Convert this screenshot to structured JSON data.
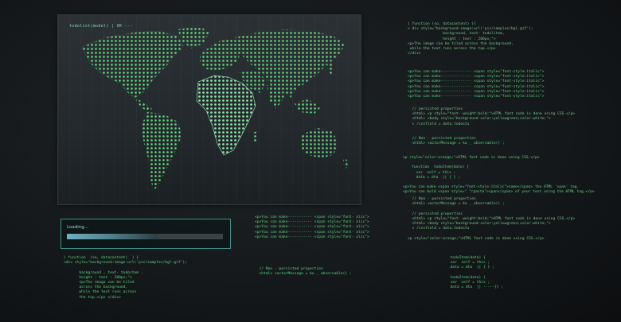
{
  "map": {
    "title": "todolist(model) | OK ---"
  },
  "loading": {
    "label": "Loading...",
    "progress": 0.58
  },
  "code_right_top": [
    "( function (so, datacontent) ){",
    "< div style=\"background-image:url('pic/samples/bgl.gif');",
    "                background, text- todolitem,",
    "                height : text : 200px;\">",
    "<p>The image can be tiled across the background,",
    " while the text runs across the top.</p>",
    "</div>"
  ],
  "code_right_mid": [
    "<p>You can make-------------- <span style=\"font-style:italic\">",
    "<p>You can make-------------- <span style=\"font-style:italic\">",
    "<p>You can make-------------- <span style=\"font-style:italic\">",
    "<p>You can make-------------- <span style=\"font-style:italic\">",
    "<p>You can make-------------- <span style=\"font-style:italic\">",
    "<p>You can make-------------- <span style=\"font-style:italic\">"
  ],
  "code_right_persisted": [
    "  // persisted properties",
    "  <html> <p style=\"font- weight:bold;\">HTML font code is done using CSS.</p>",
    "  <html> <body style=\"background-color:yellowgreen;color:white;\">",
    "  < /cssfield = data.todostu"
  ],
  "code_right_nonpersist": [
    "  // Non - persisted properties",
    "  <html> <actorMessage = ko _ observable() ;"
  ],
  "code_right_css": [
    "<p style=\"color:orange;\">HTML font code is done using CSS.</p>",
    "",
    "    function  todoItem(data) {",
    "      var  self = this ;",
    "      data = dta  || { } ;",
    "",
    "<p>You can make <span style=\"font-style:italic\">some</span> the HTML 'span' tag.",
    "<p>You can bold <span style=\" \"rpacte\">span</span> of your text using the HTML tag.</p>"
  ],
  "code_right_lower": [
    "  // Non - persisted properties",
    "  <html> <actorMessage = ko _ observable() ;",
    "",
    "  // persisted properties",
    "  <html> <p style=\"font- weight:bold;\">HTML font code is done using CSS.</p>",
    "  <html> <body style=\"background-color:yellowgreen;color:white;\">",
    "  < /cssfield = data.todostu",
    "",
    "<p style=\"color:orange;\">HTML font code is done using CSS.</p>"
  ],
  "code_right_bottom": [
    "  todoItem(data) {",
    "  var  self = this ;",
    "  data = dta  || { } ;",
    "",
    "  todoItem(data) {",
    "  var  self = this ;",
    "  data = dta  || -----{} ;"
  ],
  "code_center": [
    "<p>You can make----------- <span style=\"font- alic\">",
    "<p>You can make----------- <span style=\"font- alic\">",
    "<p>You can make----------- <span style=\"font- alic\">",
    "<p>You can make----------- <span style=\"font- alic\">",
    "<p>You can make----------- <span style=\"font- alic\">"
  ],
  "code_center_bottom": [
    "  // Non - persisted properties",
    "  <html> <actorMessage = ko _ observable() ;"
  ],
  "code_left_bottom": [
    "( function  (so, datacontent)  ) {",
    "<div style=\"background-image:url('pic/samples/bgl.gif');",
    "",
    "       background , text- todoitem ,",
    "       height : text - 200px;\">",
    "       <p>The image can be tiled",
    "       across the background,",
    "       while the text runs across",
    "       the top.</p> </div>"
  ],
  "colors": {
    "code": "#5fd37f",
    "map_dots": "#5fc97a",
    "africa_highlight": "#8fe0a8",
    "panel_border": "#3f8f8a"
  }
}
